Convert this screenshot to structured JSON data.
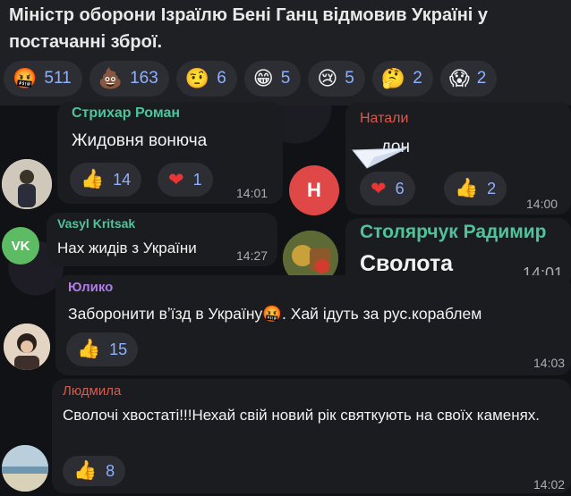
{
  "post": {
    "text": "Міністр оборони Ізраїлю Бені Ганц відмовив Україні у постачанні зброї.",
    "reactions": [
      {
        "icon": "angry-face-icon",
        "glyph": "🤬",
        "count": "511"
      },
      {
        "icon": "poop-icon",
        "glyph": "💩",
        "count": "163"
      },
      {
        "icon": "raised-eyebrow-face-icon",
        "glyph": "🤨",
        "count": "6"
      },
      {
        "icon": "grinning-face-icon",
        "glyph": "😁",
        "count": "5"
      },
      {
        "icon": "crying-face-icon",
        "glyph": "😢",
        "count": "5"
      },
      {
        "icon": "thinking-face-icon",
        "glyph": "🤔",
        "count": "2"
      },
      {
        "icon": "screaming-face-icon",
        "glyph": "😱",
        "count": "2"
      }
    ]
  },
  "comments": {
    "strykhar": {
      "author": "Стрихар Роман",
      "author_color": "#4fc39a",
      "text": "Жидовня вонюча",
      "time": "14:01",
      "reactions": [
        {
          "icon": "thumbs-up-icon",
          "glyph": "👍",
          "count": "14"
        },
        {
          "icon": "heart-icon",
          "glyph": "❤",
          "count": "1"
        }
      ]
    },
    "natali": {
      "author": "Натали",
      "author_color": "#e0574c",
      "avatar_letter": "Н",
      "avatar_color": "#e04848",
      "text": "...дон",
      "time": "14:00",
      "reactions": [
        {
          "icon": "heart-icon",
          "glyph": "❤",
          "count": "6"
        },
        {
          "icon": "thumbs-up-icon",
          "glyph": "👍",
          "count": "2"
        }
      ]
    },
    "vasyl": {
      "author": "Vasyl Kritsak",
      "author_color": "#4fc39a",
      "avatar_letter": "VK",
      "avatar_color": "#5dbb63",
      "text": "Нах жидів з України",
      "time": "14:27"
    },
    "stolyarchuk": {
      "author": "Столярчук Радимир",
      "author_color": "#4fc39a",
      "text": "Сволота",
      "time": "14:01"
    },
    "yuliko": {
      "author": "Юлико",
      "author_color": "#b07ce8",
      "text": "Заборонити вʼїзд в Україну🤬. Хай ідуть за рус.кораблем",
      "time": "14:03",
      "reactions": [
        {
          "icon": "thumbs-up-icon",
          "glyph": "👍",
          "count": "15"
        }
      ]
    },
    "lyudmyla": {
      "author": "Людмила",
      "author_color": "#e0574c",
      "text": "Сволочі хвостаті!!!Нехай свій новий рік святкують на своїх каменях.",
      "time": "14:02",
      "reactions": [
        {
          "icon": "thumbs-up-icon",
          "glyph": "👍",
          "count": "8"
        }
      ]
    }
  }
}
